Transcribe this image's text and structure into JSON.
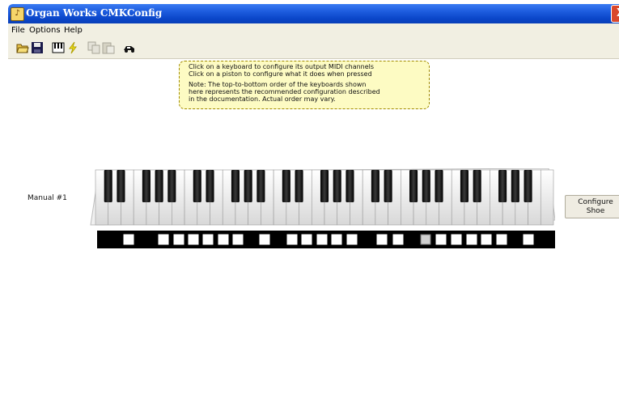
{
  "window": {
    "title": "Organ Works CMKConfig",
    "close_symbol": "X"
  },
  "menu": [
    "File",
    "Options",
    "Help"
  ],
  "toolbar": {
    "buttons": [
      {
        "name": "open-folder-icon"
      },
      {
        "name": "save-icon"
      },
      {
        "name": "keyboard-icon"
      },
      {
        "name": "lightning-icon"
      },
      {
        "name": "copy-icon"
      },
      {
        "name": "paste-icon"
      },
      {
        "name": "car-icon"
      }
    ]
  },
  "note": {
    "line1": "Click on a keyboard to configure its output MIDI channels",
    "line2": "Click on a piston to configure what it does when pressed",
    "line3": "Note: The top-to-bottom order of the keyboards shown",
    "line4": "here represents the recommended configuration described",
    "line5": "in the documentation.  Actual order may vary."
  },
  "manual_label": "Manual #1",
  "configure_button": {
    "line1": "Configure",
    "line2": "Shoe"
  },
  "colors": {
    "titlebar": "#0a46c9",
    "note_bg": "#fdfbc3",
    "piston_bar": "#000000"
  },
  "keyboard": {
    "white_keys": 36,
    "pistons_active_index": 15
  }
}
